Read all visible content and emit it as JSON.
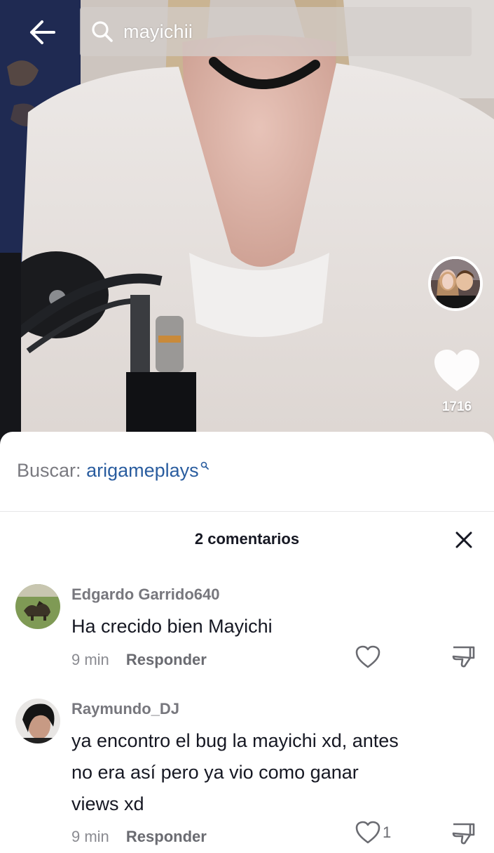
{
  "search": {
    "query": "mayichii"
  },
  "creator": {
    "like_count": "1716"
  },
  "sheet": {
    "suggest_prefix": "Buscar:",
    "suggest_term": "arigameplays",
    "comments_title": "2 comentarios"
  },
  "comments": [
    {
      "author": "Edgardo Garrido640",
      "text": "Ha crecido bien Mayichi",
      "time": "9 min",
      "reply_label": "Responder",
      "likes": ""
    },
    {
      "author": "Raymundo_DJ",
      "text": "ya encontro el bug la mayichi xd, antes no era así pero ya vio como ganar views xd",
      "time": "9 min",
      "reply_label": "Responder",
      "likes": "1"
    }
  ],
  "icons": {
    "back": "arrow-left-icon",
    "search": "magnifier-icon",
    "like": "heart-icon",
    "close": "close-x-icon",
    "dislike": "thumbs-down-icon"
  }
}
